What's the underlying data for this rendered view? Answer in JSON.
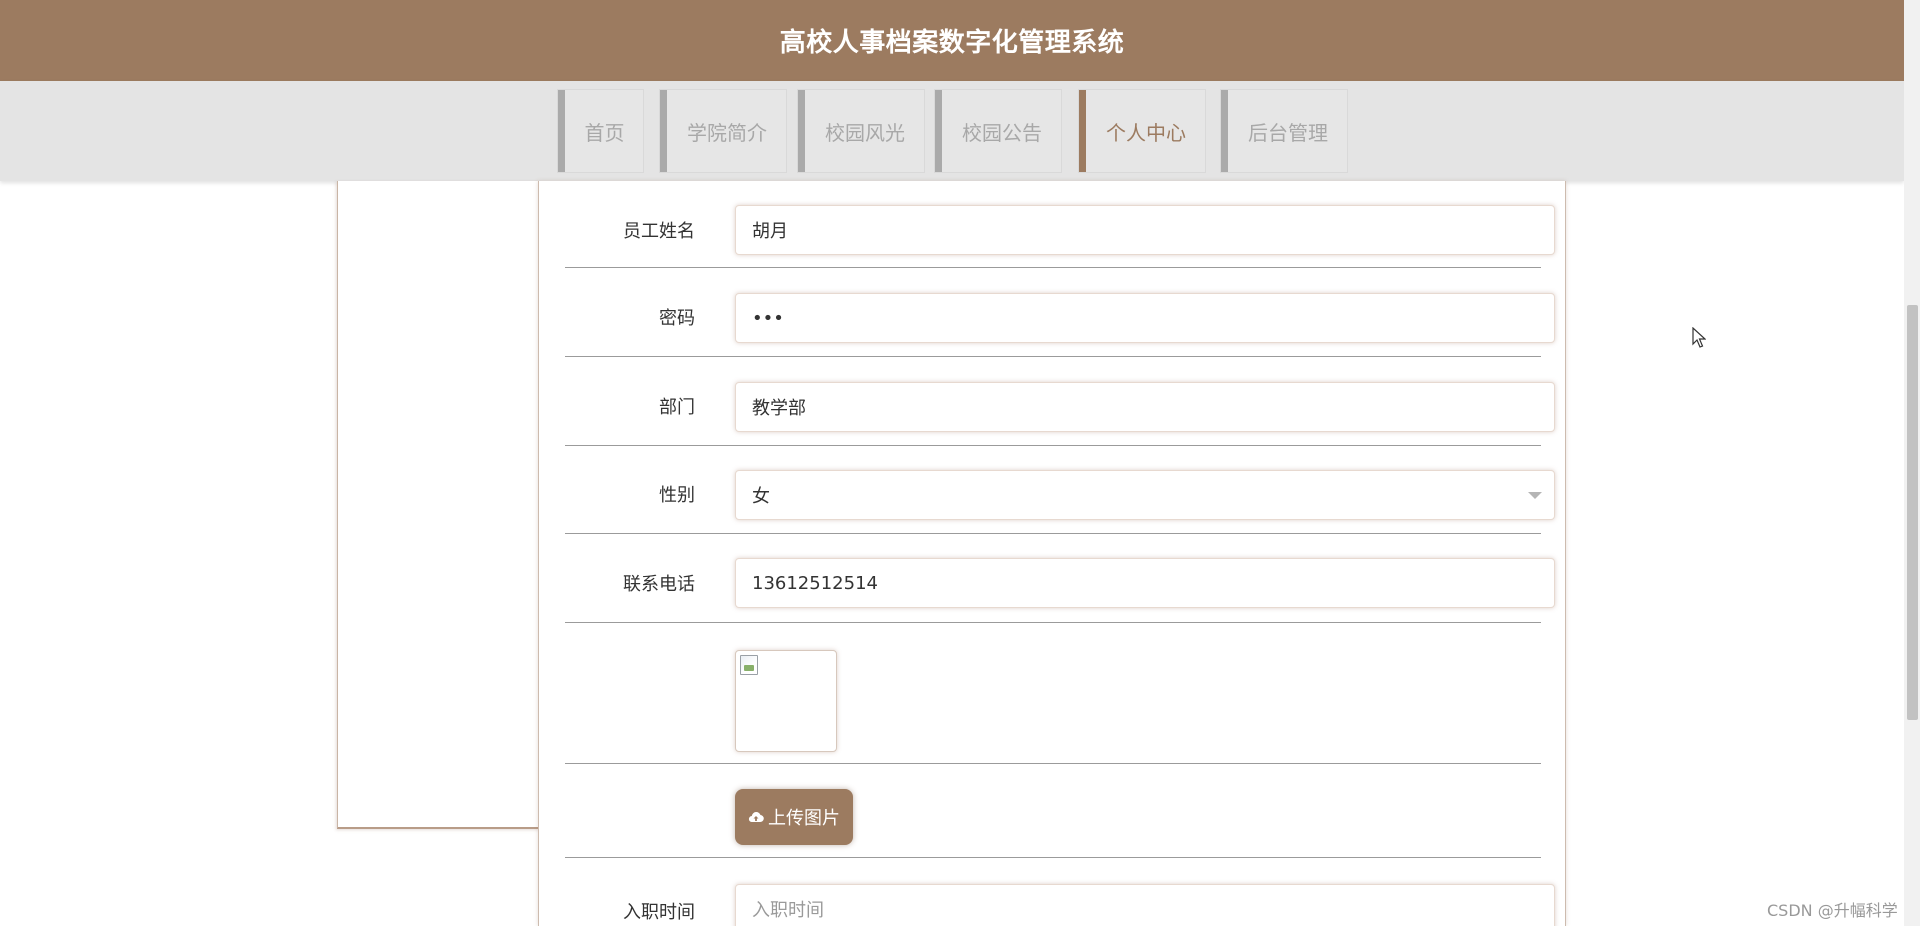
{
  "header": {
    "title": "高校人事档案数字化管理系统"
  },
  "nav": {
    "items": [
      {
        "label": "首页"
      },
      {
        "label": "学院简介"
      },
      {
        "label": "校园风光"
      },
      {
        "label": "校园公告"
      },
      {
        "label": "个人中心",
        "active": true
      },
      {
        "label": "后台管理"
      }
    ]
  },
  "form": {
    "name": {
      "label": "员工姓名",
      "value": "胡月"
    },
    "password": {
      "label": "密码",
      "value": "•••"
    },
    "department": {
      "label": "部门",
      "value": "教学部"
    },
    "gender": {
      "label": "性别",
      "value": "女"
    },
    "phone": {
      "label": "联系电话",
      "value": "13612512514"
    },
    "upload_button": {
      "label": "上传图片",
      "icon": "cloud-upload-icon"
    },
    "hire_date": {
      "label": "入职时间",
      "placeholder": "入职时间"
    }
  },
  "watermark": "CSDN @升幅科学",
  "colors": {
    "brand": "#9c7b60",
    "nav_bg": "#e4e4e4"
  }
}
